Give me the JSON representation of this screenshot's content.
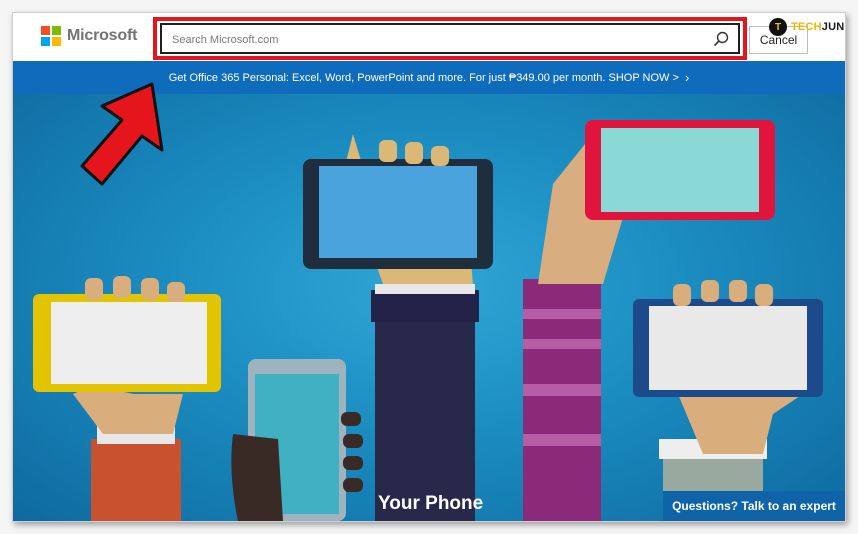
{
  "header": {
    "brand": "Microsoft",
    "search": {
      "placeholder": "Search Microsoft.com",
      "value": ""
    },
    "cancel_label": "Cancel"
  },
  "promo": {
    "text": "Get Office 365 Personal: Excel, Word, PowerPoint and more. For just ₱349.00 per month. SHOP NOW >",
    "chevron": "›"
  },
  "hero": {
    "title": "Your Phone",
    "expert_label": "Questions? Talk to an expert"
  },
  "watermark": {
    "initials": "T",
    "part1": "TECH",
    "part2": "JUNKIE"
  },
  "colors": {
    "promo_bar": "#0f6cbd",
    "highlight": "#e5151c",
    "hero_bg": "#1b8cc0",
    "logo": [
      "#f25022",
      "#7fba00",
      "#00a4ef",
      "#ffb900"
    ]
  },
  "icons": [
    "microsoft-logo",
    "search-icon",
    "chevron-right-icon",
    "red-arrow-annotation"
  ]
}
